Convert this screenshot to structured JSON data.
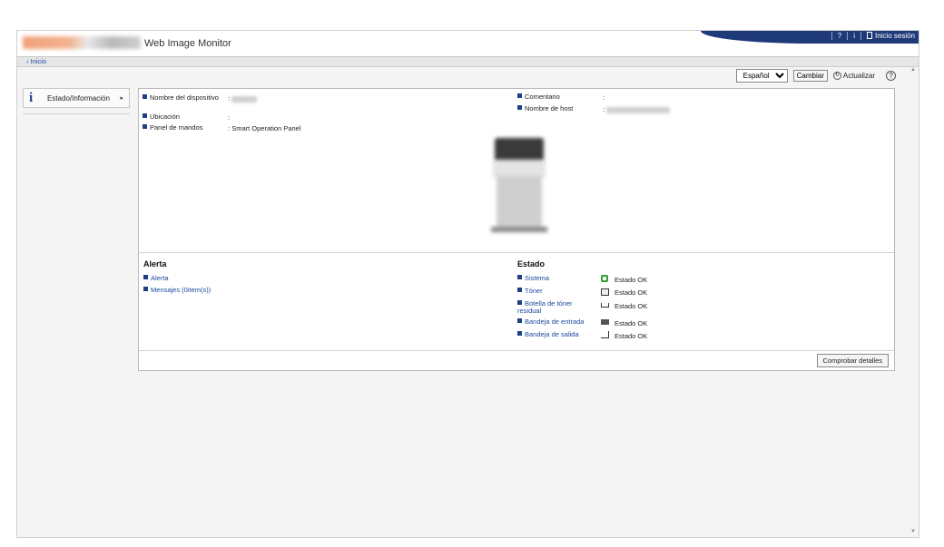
{
  "header": {
    "app_title": "Web Image Monitor",
    "help_label": "?",
    "info_label": "i",
    "login_label": "Inicio sesión",
    "accent_color": "#1f3a78"
  },
  "breadcrumb": {
    "label": "‹ Inicio"
  },
  "toolbar": {
    "language_value": "Español",
    "language_options": [
      "Español"
    ],
    "change_label": "Cambiar",
    "refresh_label": "Actualizar"
  },
  "sidebar": {
    "items": [
      {
        "label": "Estado/Información",
        "icon": "info-icon"
      }
    ]
  },
  "device_info": {
    "left": [
      {
        "label": "Nombre del dispositivo",
        "value": ""
      },
      {
        "label": "Ubicación",
        "value": ""
      },
      {
        "label": "Panel de mandos",
        "value": "Smart Operation Panel"
      }
    ],
    "right": [
      {
        "label": "Comentario",
        "value": ""
      },
      {
        "label": "Nombre de host",
        "value": ""
      }
    ],
    "separator": ":"
  },
  "alerts": {
    "title": "Alerta",
    "links": [
      "Alerta",
      "Mensajes (0item(s))"
    ]
  },
  "status": {
    "title": "Estado",
    "items": [
      {
        "label": "Sistema",
        "icon": "system-ok-icon",
        "value": "Estado OK"
      },
      {
        "label": "Tóner",
        "icon": "toner-icon",
        "value": "Estado OK"
      },
      {
        "label": "Botella de tóner residual",
        "icon": "waste-toner-icon",
        "value": "Estado OK"
      },
      {
        "label": "Bandeja de entrada",
        "icon": "input-tray-icon",
        "value": "Estado OK"
      },
      {
        "label": "Bandeja de salida",
        "icon": "output-tray-icon",
        "value": "Estado OK"
      }
    ]
  },
  "details_button": {
    "label": "Comprobar detalles"
  }
}
